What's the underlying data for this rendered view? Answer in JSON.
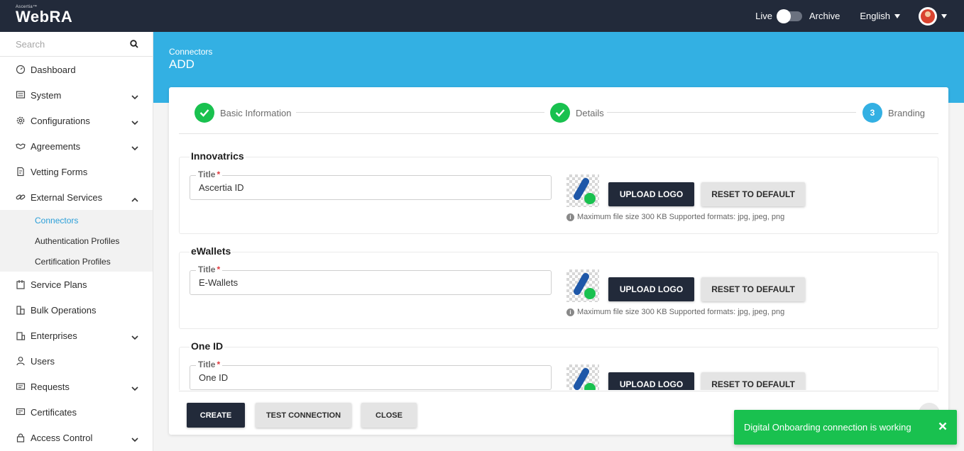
{
  "app": {
    "brand_small": "Ascertia™",
    "brand_name": "WebRA"
  },
  "header": {
    "live_label": "Live",
    "archive_label": "Archive",
    "language": "English"
  },
  "sidebar": {
    "search_placeholder": "Search",
    "items": [
      {
        "label": "Dashboard",
        "icon": "dashboard-icon",
        "expandable": false
      },
      {
        "label": "System",
        "icon": "system-icon",
        "expandable": true
      },
      {
        "label": "Configurations",
        "icon": "gear-icon",
        "expandable": true
      },
      {
        "label": "Agreements",
        "icon": "handshake-icon",
        "expandable": true
      },
      {
        "label": "Vetting Forms",
        "icon": "form-icon",
        "expandable": false
      },
      {
        "label": "External Services",
        "icon": "link-icon",
        "expandable": true,
        "expanded": true
      },
      {
        "label": "Service Plans",
        "icon": "plans-icon",
        "expandable": false
      },
      {
        "label": "Bulk Operations",
        "icon": "bulk-icon",
        "expandable": false
      },
      {
        "label": "Enterprises",
        "icon": "enterprise-icon",
        "expandable": true
      },
      {
        "label": "Users",
        "icon": "user-icon",
        "expandable": false
      },
      {
        "label": "Requests",
        "icon": "request-icon",
        "expandable": true
      },
      {
        "label": "Certificates",
        "icon": "certificate-icon",
        "expandable": false
      },
      {
        "label": "Access Control",
        "icon": "lock-icon",
        "expandable": true
      }
    ],
    "subitems": [
      {
        "label": "Connectors",
        "active": true
      },
      {
        "label": "Authentication Profiles",
        "active": false
      },
      {
        "label": "Certification Profiles",
        "active": false
      }
    ]
  },
  "page": {
    "breadcrumb": "Connectors",
    "title": "ADD"
  },
  "stepper": {
    "steps": [
      {
        "label": "Basic Information",
        "status": "done"
      },
      {
        "label": "Details",
        "status": "done"
      },
      {
        "label": "Branding",
        "status": "current",
        "number": "3"
      }
    ]
  },
  "branding": {
    "sections": [
      {
        "name": "Innovatrics",
        "title_label": "Title",
        "title_value": "Ascertia ID"
      },
      {
        "name": "eWallets",
        "title_label": "Title",
        "title_value": "E-Wallets"
      },
      {
        "name": "One ID",
        "title_label": "Title",
        "title_value": "One ID"
      }
    ],
    "upload_label": "UPLOAD LOGO",
    "reset_label": "RESET TO DEFAULT",
    "hint": "Maximum file size 300 KB Supported formats: jpg, jpeg, png",
    "required_mark": "*"
  },
  "footer": {
    "create_label": "CREATE",
    "test_label": "TEST CONNECTION",
    "close_label": "CLOSE"
  },
  "toast": {
    "message": "Digital Onboarding connection is working"
  },
  "colors": {
    "topbar": "#222a3a",
    "accent": "#33b0e3",
    "success": "#19c14f",
    "active_link": "#2b9fd8"
  }
}
